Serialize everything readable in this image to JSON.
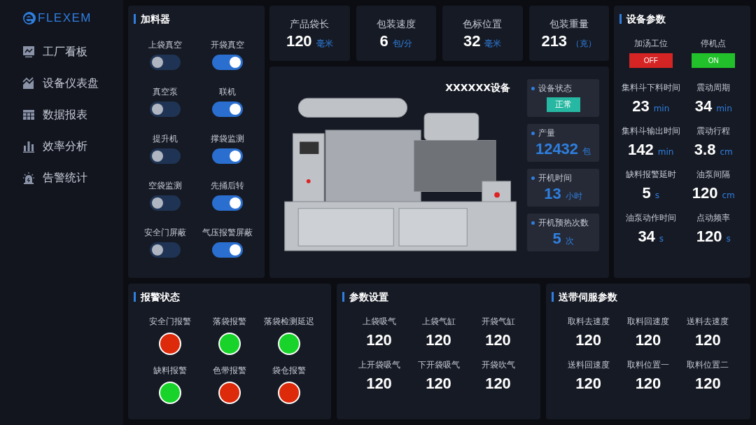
{
  "logo": {
    "text": "FLEXEM"
  },
  "sidebar": {
    "items": [
      {
        "label": "工厂看板"
      },
      {
        "label": "设备仪表盘"
      },
      {
        "label": "数据报表"
      },
      {
        "label": "效率分析"
      },
      {
        "label": "告警统计"
      }
    ]
  },
  "feeder": {
    "title": "加料器",
    "switches": [
      {
        "label": "上袋真空",
        "on": false
      },
      {
        "label": "开袋真空",
        "on": true
      },
      {
        "label": "真空泵",
        "on": false
      },
      {
        "label": "联机",
        "on": true
      },
      {
        "label": "提升机",
        "on": false
      },
      {
        "label": "撑袋监测",
        "on": true
      },
      {
        "label": "空袋监测",
        "on": false
      },
      {
        "label": "先捅后转",
        "on": true
      },
      {
        "label": "安全门屏蔽",
        "on": false
      },
      {
        "label": "气压报警屏蔽",
        "on": true
      }
    ]
  },
  "stats": [
    {
      "label": "产品袋长",
      "value": "120",
      "unit": "毫米"
    },
    {
      "label": "包装速度",
      "value": "6",
      "unit": "包/分"
    },
    {
      "label": "色标位置",
      "value": "32",
      "unit": "毫米"
    },
    {
      "label": "包装重量",
      "value": "213",
      "unit": "（克）"
    }
  ],
  "machine": {
    "title": "XXXXXX设备",
    "status_label": "设备状态",
    "status": "正常",
    "cards": [
      {
        "label": "产量",
        "value": "12432",
        "unit": "包"
      },
      {
        "label": "开机时间",
        "value": "13",
        "unit": "小时"
      },
      {
        "label": "开机预热次数",
        "value": "5",
        "unit": "次"
      }
    ]
  },
  "device_params": {
    "title": "设备参数",
    "toggles": [
      {
        "label": "加汤工位",
        "text": "OFF",
        "on": false
      },
      {
        "label": "停机点",
        "text": "ON",
        "on": true
      }
    ],
    "params": [
      {
        "label": "集料斗下料时间",
        "value": "23",
        "unit": "min"
      },
      {
        "label": "震动周期",
        "value": "34",
        "unit": "min"
      },
      {
        "label": "集料斗输出时间",
        "value": "142",
        "unit": "min"
      },
      {
        "label": "震动行程",
        "value": "3.8",
        "unit": "cm"
      },
      {
        "label": "缺料报警延时",
        "value": "5",
        "unit": "s"
      },
      {
        "label": "油泵间隔",
        "value": "120",
        "unit": "cm"
      },
      {
        "label": "油泵动作时间",
        "value": "34",
        "unit": "s"
      },
      {
        "label": "点动频率",
        "value": "120",
        "unit": "s"
      }
    ]
  },
  "alarms": {
    "title": "报警状态",
    "items": [
      {
        "label": "安全门报警",
        "color": "#dd2a0a"
      },
      {
        "label": "落袋报警",
        "color": "#18d42a"
      },
      {
        "label": "落袋检测延迟",
        "color": "#18d42a"
      },
      {
        "label": "缺料报警",
        "color": "#18d42a"
      },
      {
        "label": "色带报警",
        "color": "#dd2a0a"
      },
      {
        "label": "袋仓报警",
        "color": "#dd2a0a"
      }
    ]
  },
  "settings": {
    "title": "参数设置",
    "items": [
      {
        "label": "上袋吸气",
        "value": "120"
      },
      {
        "label": "上袋气缸",
        "value": "120"
      },
      {
        "label": "开袋气缸",
        "value": "120"
      },
      {
        "label": "上开袋吸气",
        "value": "120"
      },
      {
        "label": "下开袋吸气",
        "value": "120"
      },
      {
        "label": "开袋吹气",
        "value": "120"
      }
    ]
  },
  "servo": {
    "title": "送带伺服参数",
    "items": [
      {
        "label": "取料去速度",
        "value": "120"
      },
      {
        "label": "取料回速度",
        "value": "120"
      },
      {
        "label": "送料去速度",
        "value": "120"
      },
      {
        "label": "送料回速度",
        "value": "120"
      },
      {
        "label": "取料位置一",
        "value": "120"
      },
      {
        "label": "取料位置二",
        "value": "120"
      }
    ]
  }
}
